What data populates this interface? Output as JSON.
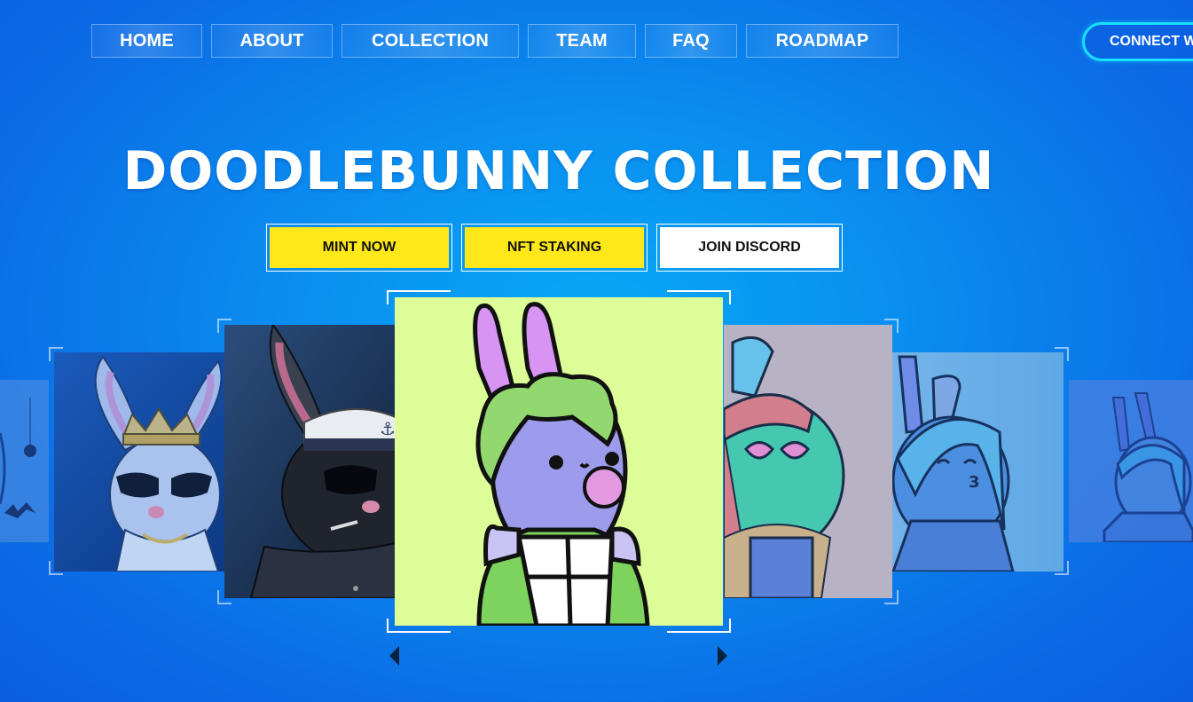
{
  "nav": {
    "items": [
      {
        "label": "HOME"
      },
      {
        "label": "ABOUT"
      },
      {
        "label": "COLLECTION"
      },
      {
        "label": "TEAM"
      },
      {
        "label": "FAQ"
      },
      {
        "label": "ROADMAP"
      }
    ],
    "connect_label": "CONNECT W"
  },
  "hero": {
    "title": "DOODLEBUNNY COLLECTION",
    "buttons": {
      "mint": "MINT NOW",
      "staking": "NFT STAKING",
      "discord": "JOIN DISCORD"
    }
  },
  "colors": {
    "accent_yellow": "#ffe81a",
    "connect_border": "#19e0ff",
    "background": "#0a8ff0"
  },
  "carousel": {
    "icons": [
      "chevron-left-icon",
      "chevron-right-icon"
    ]
  }
}
